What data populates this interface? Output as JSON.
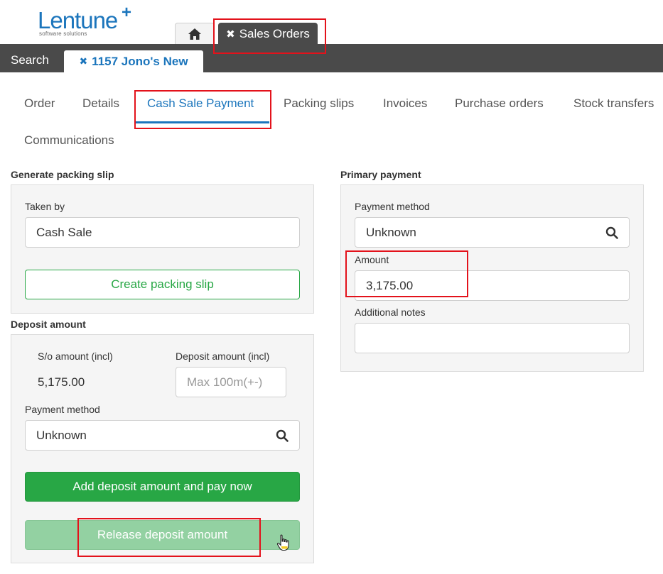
{
  "brand": {
    "name": "Lentune",
    "plus": "+",
    "tagline": "software solutions"
  },
  "module_tabs": {
    "home_icon": "home-icon",
    "sales_close": "✖",
    "sales_label": "Sales Orders"
  },
  "doc_bar": {
    "search_label": "Search",
    "doc_close": "✖",
    "doc_label": "1157 Jono's New"
  },
  "section_tabs": {
    "order": "Order",
    "details": "Details",
    "cash_sale_payment": "Cash Sale Payment",
    "packing_slips": "Packing slips",
    "invoices": "Invoices",
    "purchase_orders": "Purchase orders",
    "stock_transfers": "Stock transfers",
    "communications": "Communications",
    "active": "Cash Sale Payment"
  },
  "packing": {
    "title": "Generate packing slip",
    "taken_by_label": "Taken by",
    "taken_by_value": "Cash Sale",
    "create_button": "Create packing slip"
  },
  "deposit": {
    "title": "Deposit amount",
    "so_amount_label": "S/o amount (incl)",
    "so_amount_value": "5,175.00",
    "deposit_label": "Deposit amount (incl)",
    "deposit_placeholder": "Max 100m(+-)",
    "payment_method_label": "Payment method",
    "payment_method_value": "Unknown",
    "add_button": "Add deposit amount and pay now",
    "release_button": "Release deposit amount"
  },
  "primary": {
    "title": "Primary payment",
    "payment_method_label": "Payment method",
    "payment_method_value": "Unknown",
    "amount_label": "Amount",
    "amount_value": "3,175.00",
    "notes_label": "Additional notes",
    "notes_value": ""
  },
  "colors": {
    "accent": "#1b75bc",
    "dark_bar": "#4a4a4a",
    "success": "#28a745",
    "annotation": "#e3121b"
  }
}
